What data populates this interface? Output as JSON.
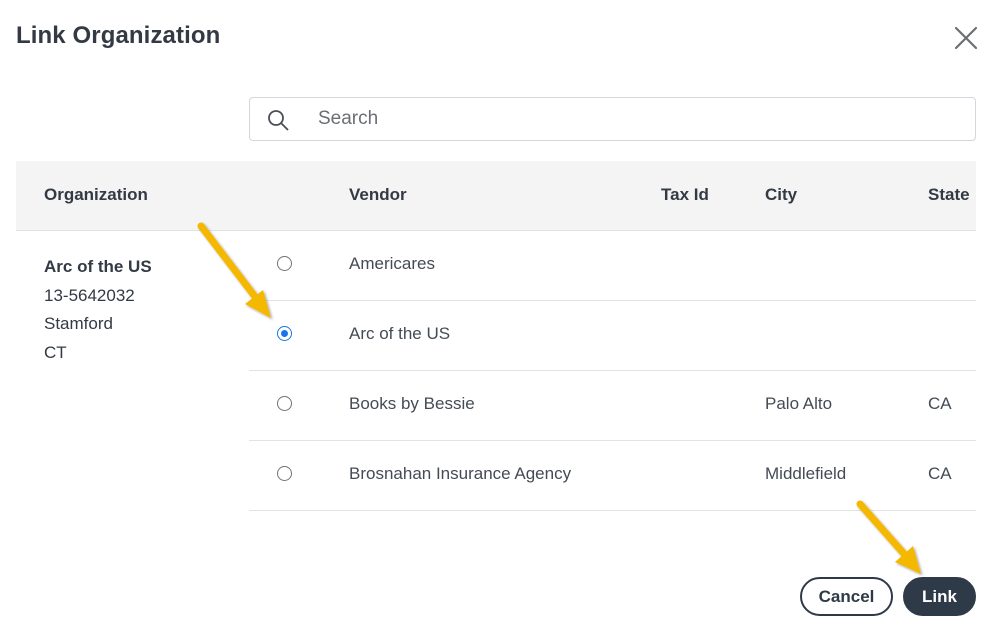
{
  "dialog": {
    "title": "Link Organization"
  },
  "search": {
    "placeholder": "Search",
    "value": ""
  },
  "table": {
    "headers": {
      "organization": "Organization",
      "vendor": "Vendor",
      "tax_id": "Tax Id",
      "city": "City",
      "state": "State"
    },
    "rows": [
      {
        "vendor": "Americares",
        "tax_id": "",
        "city": "",
        "state": "",
        "selected": false
      },
      {
        "vendor": "Arc of the US",
        "tax_id": "",
        "city": "",
        "state": "",
        "selected": true
      },
      {
        "vendor": "Books by Bessie",
        "tax_id": "",
        "city": "Palo Alto",
        "state": "CA",
        "selected": false
      },
      {
        "vendor": "Brosnahan Insurance Agency",
        "tax_id": "",
        "city": "Middlefield",
        "state": "CA",
        "selected": false
      },
      {
        "vendor": "",
        "tax_id": "",
        "city": "",
        "state": "",
        "selected": false
      }
    ]
  },
  "organization": {
    "name": "Arc of the US",
    "tax_id": "13-5642032",
    "city": "Stamford",
    "state": "CT"
  },
  "footer": {
    "cancel_label": "Cancel",
    "link_label": "Link"
  },
  "colors": {
    "primary_button": "#2f3a48",
    "radio_selected": "#1a73e8",
    "annotation_arrow": "#f5b800",
    "header_bg": "#f4f4f4"
  },
  "icons": {
    "close": "close-icon",
    "search": "search-icon",
    "annotation": "arrow-annotation-icon"
  }
}
